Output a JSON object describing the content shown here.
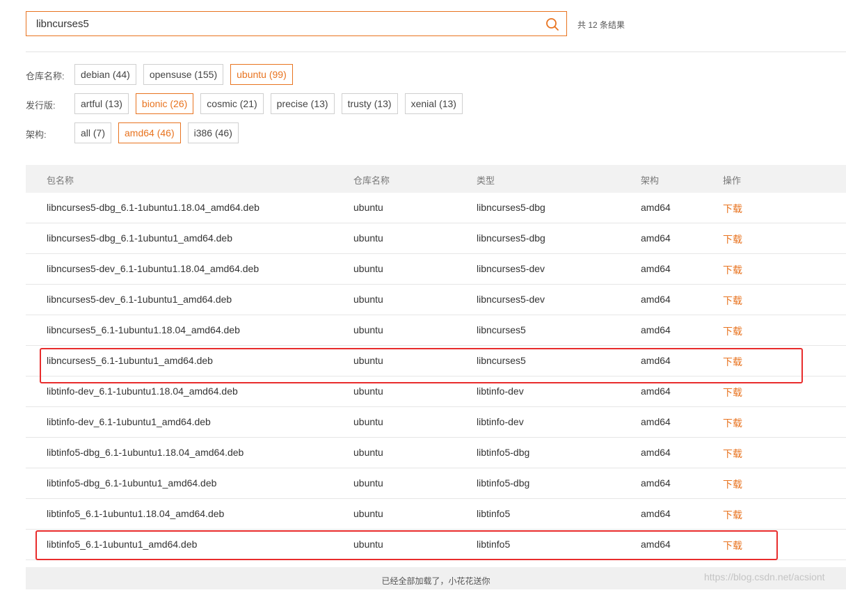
{
  "search": {
    "value": "libncurses5",
    "result_count": "共 12 条结果"
  },
  "filters": [
    {
      "label": "仓库名称:",
      "chips": [
        {
          "text": "debian (44)",
          "active": false
        },
        {
          "text": "opensuse (155)",
          "active": false
        },
        {
          "text": "ubuntu (99)",
          "active": true
        }
      ]
    },
    {
      "label": "发行版:",
      "chips": [
        {
          "text": "artful (13)",
          "active": false
        },
        {
          "text": "bionic (26)",
          "active": true
        },
        {
          "text": "cosmic (21)",
          "active": false
        },
        {
          "text": "precise (13)",
          "active": false
        },
        {
          "text": "trusty (13)",
          "active": false
        },
        {
          "text": "xenial (13)",
          "active": false
        }
      ]
    },
    {
      "label": "架构:",
      "chips": [
        {
          "text": "all (7)",
          "active": false
        },
        {
          "text": "amd64 (46)",
          "active": true
        },
        {
          "text": "i386 (46)",
          "active": false
        }
      ]
    }
  ],
  "table": {
    "headers": [
      "包名称",
      "仓库名称",
      "类型",
      "架构",
      "操作"
    ],
    "rows": [
      [
        "libncurses5-dbg_6.1-1ubuntu1.18.04_amd64.deb",
        "ubuntu",
        "libncurses5-dbg",
        "amd64",
        "下载"
      ],
      [
        "libncurses5-dbg_6.1-1ubuntu1_amd64.deb",
        "ubuntu",
        "libncurses5-dbg",
        "amd64",
        "下载"
      ],
      [
        "libncurses5-dev_6.1-1ubuntu1.18.04_amd64.deb",
        "ubuntu",
        "libncurses5-dev",
        "amd64",
        "下载"
      ],
      [
        "libncurses5-dev_6.1-1ubuntu1_amd64.deb",
        "ubuntu",
        "libncurses5-dev",
        "amd64",
        "下载"
      ],
      [
        "libncurses5_6.1-1ubuntu1.18.04_amd64.deb",
        "ubuntu",
        "libncurses5",
        "amd64",
        "下载"
      ],
      [
        "libncurses5_6.1-1ubuntu1_amd64.deb",
        "ubuntu",
        "libncurses5",
        "amd64",
        "下载"
      ],
      [
        "libtinfo-dev_6.1-1ubuntu1.18.04_amd64.deb",
        "ubuntu",
        "libtinfo-dev",
        "amd64",
        "下载"
      ],
      [
        "libtinfo-dev_6.1-1ubuntu1_amd64.deb",
        "ubuntu",
        "libtinfo-dev",
        "amd64",
        "下载"
      ],
      [
        "libtinfo5-dbg_6.1-1ubuntu1.18.04_amd64.deb",
        "ubuntu",
        "libtinfo5-dbg",
        "amd64",
        "下载"
      ],
      [
        "libtinfo5-dbg_6.1-1ubuntu1_amd64.deb",
        "ubuntu",
        "libtinfo5-dbg",
        "amd64",
        "下载"
      ],
      [
        "libtinfo5_6.1-1ubuntu1.18.04_amd64.deb",
        "ubuntu",
        "libtinfo5",
        "amd64",
        "下载"
      ],
      [
        "libtinfo5_6.1-1ubuntu1_amd64.deb",
        "ubuntu",
        "libtinfo5",
        "amd64",
        "下载"
      ]
    ]
  },
  "footer": {
    "text": "已经全部加载了，小花花送你"
  },
  "watermark": "https://blog.csdn.net/acsiont",
  "colors": {
    "accent": "#e8731f",
    "highlight": "#e82c2c",
    "header_bg": "#f2f2f2"
  },
  "icons": {
    "search": "search-icon"
  }
}
